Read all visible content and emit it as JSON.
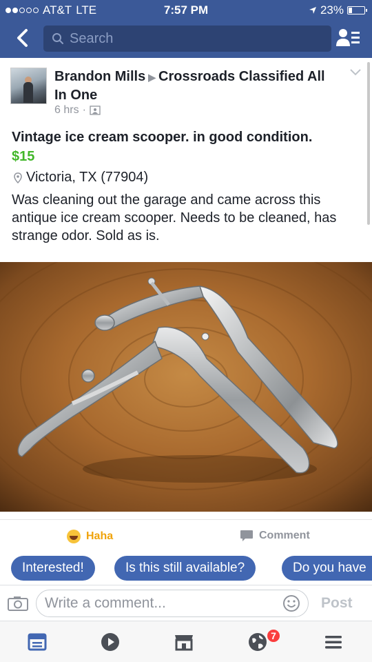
{
  "status_bar": {
    "carrier": "AT&T",
    "network": "LTE",
    "time": "7:57 PM",
    "battery": "23%",
    "battery_level": 0.23
  },
  "nav": {
    "search_placeholder": "Search"
  },
  "post": {
    "author": "Brandon Mills",
    "group": "Crossroads Classified All In One",
    "time_ago": "6 hrs",
    "title": "Vintage ice cream scooper. in good condition.",
    "price": "$15",
    "location": "Victoria, TX (77904)",
    "description": "Was cleaning out the garage and came across this antique ice cream scooper. Needs to be cleaned, has strange odor. Sold as is."
  },
  "actions": {
    "reaction_label": "Haha",
    "comment_label": "Comment"
  },
  "quick_replies": [
    "Interested!",
    "Is this still available?",
    "Do you have"
  ],
  "comment_bar": {
    "placeholder": "Write a comment...",
    "post_label": "Post"
  },
  "tabs": {
    "notification_count": "7",
    "icons": [
      "news-feed-icon",
      "video-icon",
      "marketplace-icon",
      "notifications-globe-icon",
      "menu-icon"
    ]
  },
  "colors": {
    "header": "#3b5998",
    "price": "#42b72a",
    "chip": "#4267b2",
    "haha": "#f0a30a",
    "badge": "#fa3e3e"
  }
}
